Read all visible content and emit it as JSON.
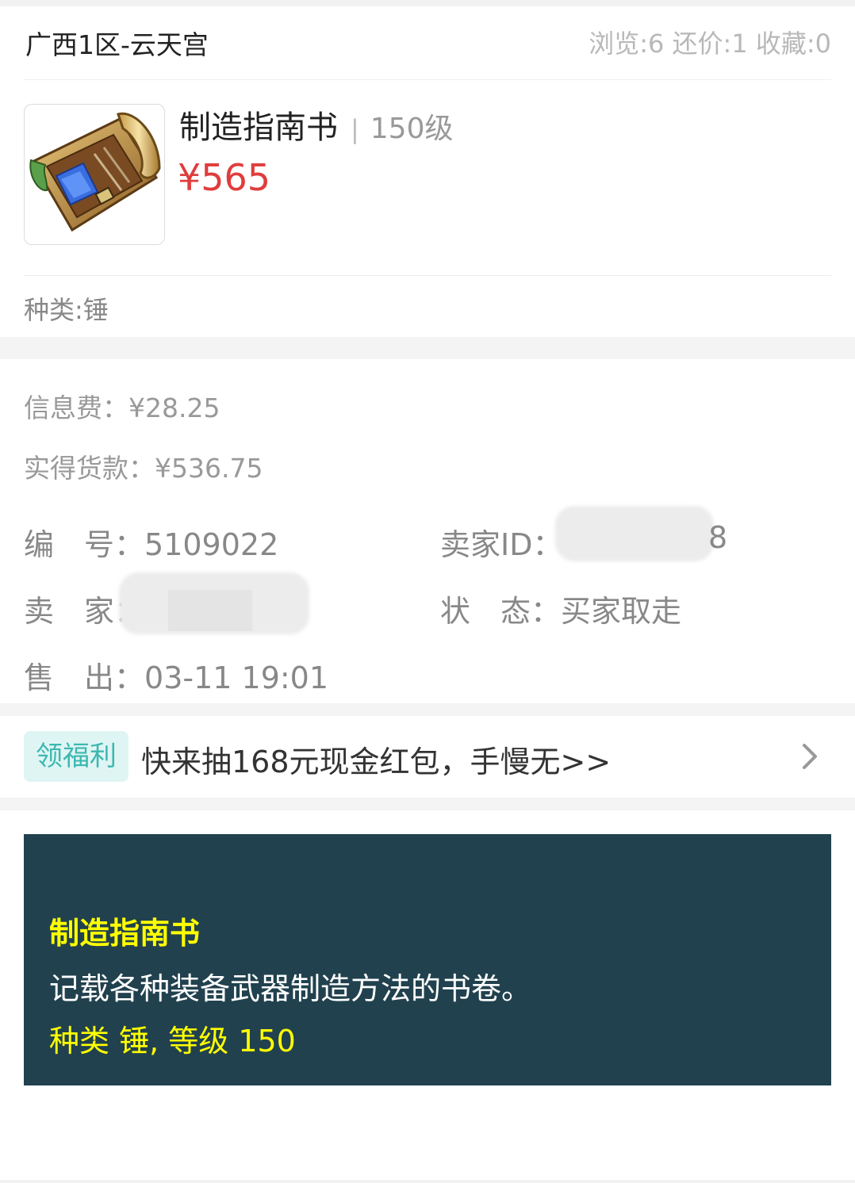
{
  "header": {
    "server": "广西1区-云天宫",
    "stats": "浏览:6 还价:1 收藏:0"
  },
  "item": {
    "icon": "scroll-book-icon",
    "name": "制造指南书",
    "level": "150级",
    "price": "¥565",
    "category": "种类:锤"
  },
  "fees": {
    "info_fee": "信息费：¥28.25",
    "net_income": "实得货款：¥536.75"
  },
  "details": {
    "number_label": "编　号：",
    "number_value": "5109022",
    "seller_id_label": "卖家ID：",
    "seller_id_tail": "8",
    "seller_label": "卖　家：",
    "status_label": "状　态：",
    "status_value": "买家取走",
    "sold_label": "售　出：",
    "sold_value": "03-11 19:01"
  },
  "promo": {
    "tag": "领福利",
    "text": "快来抽168元现金红包，手慢无>>",
    "arrow_icon": "chevron-right-icon"
  },
  "description": {
    "title": "制造指南书",
    "text": "记载各种装备武器制造方法的书卷。",
    "attributes": "种类 锤, 等级 150"
  },
  "colors": {
    "price": "#e03c3c",
    "tooltip_bg": "#21414e",
    "tooltip_highlight": "#ffff00",
    "promo_tag_bg": "#dff5f4",
    "promo_tag_text": "#3cb8b0"
  }
}
